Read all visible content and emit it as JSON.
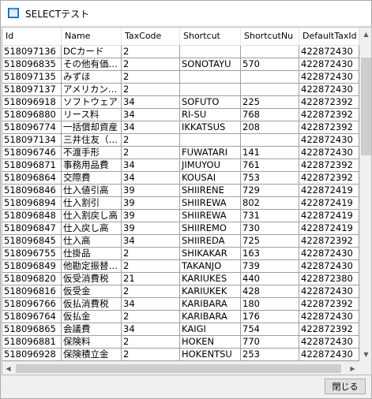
{
  "window": {
    "title": "SELECTテスト"
  },
  "grid": {
    "columns": [
      "Id",
      "Name",
      "TaxCode",
      "Shortcut",
      "ShortcutNu",
      "DefaultTaxId"
    ],
    "rows": [
      [
        "518097136",
        "DCカード",
        "2",
        "",
        "",
        "422872430"
      ],
      [
        "518096835",
        "その他有価…",
        "2",
        "SONOTAYU",
        "570",
        "422872430"
      ],
      [
        "518097135",
        "みずほ",
        "2",
        "",
        "",
        "422872430"
      ],
      [
        "518097137",
        "アメリカン…",
        "2",
        "",
        "",
        "422872430"
      ],
      [
        "518096918",
        "ソフトウェア",
        "34",
        "SOFUTO",
        "225",
        "422872392"
      ],
      [
        "518096880",
        "リース料",
        "34",
        "RI-SU",
        "768",
        "422872392"
      ],
      [
        "518096774",
        "一括償却資産",
        "34",
        "IKKATSUS",
        "208",
        "422872392"
      ],
      [
        "518097134",
        "三井住友（…",
        "2",
        "",
        "",
        "422872430"
      ],
      [
        "518096746",
        "不渡手形",
        "2",
        "FUWATARI",
        "141",
        "422872430"
      ],
      [
        "518096871",
        "事務用品費",
        "34",
        "JIMUYOU",
        "761",
        "422872392"
      ],
      [
        "518096864",
        "交際費",
        "34",
        "KOUSAI",
        "753",
        "422872392"
      ],
      [
        "518096846",
        "仕入値引高",
        "39",
        "SHIIRENE",
        "729",
        "422872419"
      ],
      [
        "518096894",
        "仕入割引",
        "39",
        "SHIIREWA",
        "802",
        "422872419"
      ],
      [
        "518096848",
        "仕入割戻し高",
        "39",
        "SHIIREWA",
        "731",
        "422872419"
      ],
      [
        "518096847",
        "仕入戻し高",
        "39",
        "SHIIREMO",
        "730",
        "422872419"
      ],
      [
        "518096845",
        "仕入高",
        "34",
        "SHIIREDA",
        "725",
        "422872392"
      ],
      [
        "518096755",
        "仕掛品",
        "2",
        "SHIKAKAR",
        "163",
        "422872430"
      ],
      [
        "518096849",
        "他勘定振替…",
        "2",
        "TAKANJO",
        "739",
        "422872430"
      ],
      [
        "518096820",
        "仮受消費税",
        "21",
        "KARIUKES",
        "440",
        "422872380"
      ],
      [
        "518096816",
        "仮受金",
        "2",
        "KARIUKEK",
        "428",
        "422872430"
      ],
      [
        "518096766",
        "仮払消費税",
        "34",
        "KARIBARA",
        "180",
        "422872392"
      ],
      [
        "518096764",
        "仮払金",
        "2",
        "KARIBARA",
        "176",
        "422872430"
      ],
      [
        "518096865",
        "会議費",
        "34",
        "KAIGI",
        "754",
        "422872392"
      ],
      [
        "518096881",
        "保険料",
        "2",
        "HOKEN",
        "770",
        "422872430"
      ],
      [
        "518096928",
        "保険積立金",
        "2",
        "HOKENTSU",
        "253",
        "422872430"
      ]
    ]
  },
  "buttons": {
    "close_label": "閉じる"
  },
  "icons": {
    "app": "app-window-icon",
    "scroll_up": "scroll-up-arrow-icon",
    "scroll_down": "scroll-down-arrow-icon",
    "scroll_left": "scroll-left-arrow-icon",
    "scroll_right": "scroll-right-arrow-icon"
  }
}
